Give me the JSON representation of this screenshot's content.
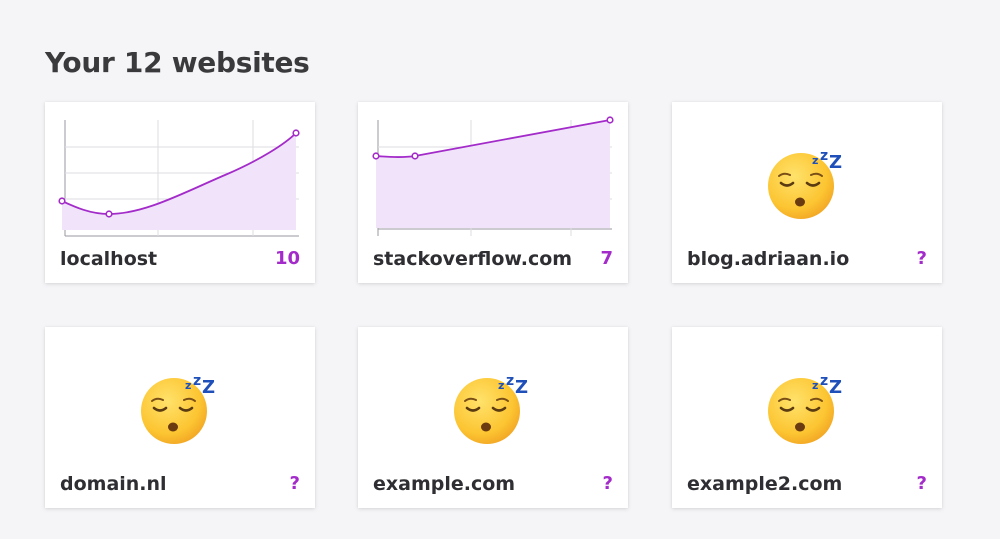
{
  "header": {
    "title": "Your 12 websites"
  },
  "colors": {
    "accent": "#a32bc9",
    "fill": "#f1e4fa",
    "grid": "#d9d9de"
  },
  "sites": [
    {
      "name": "localhost",
      "count": "10",
      "icon": "chart"
    },
    {
      "name": "stackoverflow.com",
      "count": "7",
      "icon": "chart"
    },
    {
      "name": "blog.adriaan.io",
      "count": "?",
      "icon": "sleeping-face-icon"
    },
    {
      "name": "domain.nl",
      "count": "?",
      "icon": "sleeping-face-icon"
    },
    {
      "name": "example.com",
      "count": "?",
      "icon": "sleeping-face-icon"
    },
    {
      "name": "example2.com",
      "count": "?",
      "icon": "sleeping-face-icon"
    }
  ],
  "chart_data": [
    {
      "type": "area",
      "x": [
        0,
        1,
        2,
        3,
        4,
        5,
        6
      ],
      "values": [
        3,
        2,
        3.3,
        5.5,
        7.8,
        10,
        12
      ],
      "ylim": [
        0,
        12
      ]
    },
    {
      "type": "area",
      "x": [
        0,
        1,
        2,
        3,
        4,
        5
      ],
      "values": [
        6,
        6,
        6.4,
        6.8,
        7.2,
        7.6
      ],
      "ylim": [
        0,
        8
      ]
    }
  ]
}
